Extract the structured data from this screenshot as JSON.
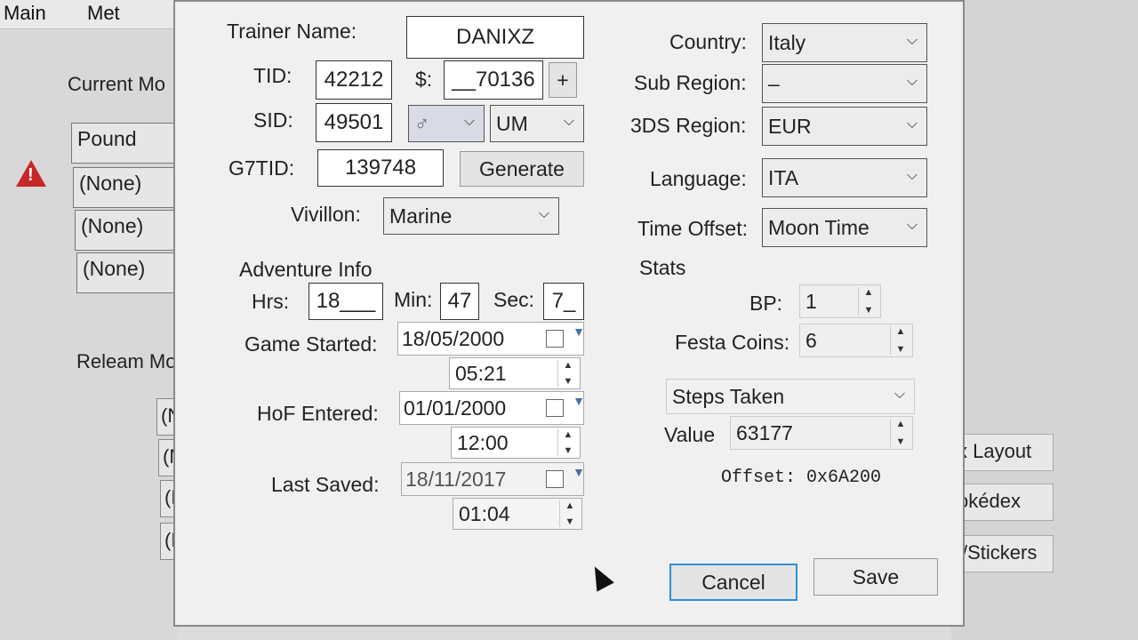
{
  "bg": {
    "menu": [
      "Main",
      "Met"
    ],
    "current_moves_label": "Current Mo",
    "moves": [
      "Pound",
      "(None)",
      "(None)",
      "(None)"
    ],
    "relearn_label": "Releam Mo",
    "relearn": [
      "(N",
      "(N",
      "(N",
      "(N"
    ],
    "side_buttons": [
      "x Layout",
      "okédex",
      "s/Stickers"
    ]
  },
  "trainer": {
    "name_label": "Trainer Name:",
    "name": "DANIXZ",
    "tid_label": "TID:",
    "tid": "42212",
    "money_label": "$:",
    "money": "__70136",
    "plus": "+",
    "sid_label": "SID:",
    "sid": "49501",
    "gender": "♂",
    "version": "UM",
    "g7tid_label": "G7TID:",
    "g7tid": "139748",
    "generate": "Generate",
    "vivillon_label": "Vivillon:",
    "vivillon": "Marine"
  },
  "region": {
    "country_label": "Country:",
    "country": "Italy",
    "subregion_label": "Sub Region:",
    "subregion": "–",
    "ds_label": "3DS Region:",
    "ds": "EUR",
    "language_label": "Language:",
    "language": "ITA",
    "time_offset_label": "Time Offset:",
    "time_offset": "Moon Time"
  },
  "adventure": {
    "title": "Adventure Info",
    "hrs_label": "Hrs:",
    "hrs": "18___",
    "min_label": "Min:",
    "min": "47",
    "sec_label": "Sec:",
    "sec": "7_",
    "started_label": "Game Started:",
    "started_date": "18/05/2000",
    "started_time": "05:21",
    "hof_label": "HoF Entered:",
    "hof_date": "01/01/2000",
    "hof_time": "12:00",
    "saved_label": "Last Saved:",
    "saved_date": "18/11/2017",
    "saved_time": "01:04"
  },
  "stats": {
    "title": "Stats",
    "bp_label": "BP:",
    "bp": "1",
    "festa_label": "Festa Coins:",
    "festa": "6",
    "stat_select": "Steps Taken",
    "value_label": "Value",
    "value": "63177",
    "offset": "Offset: 0x6A200"
  },
  "buttons": {
    "cancel": "Cancel",
    "save": "Save"
  }
}
